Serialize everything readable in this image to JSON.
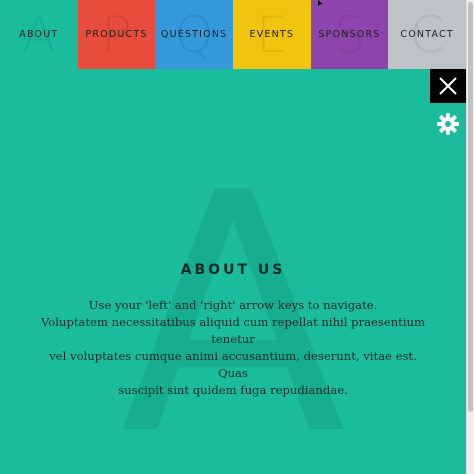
{
  "nav": {
    "items": [
      {
        "label": "ABOUT",
        "letter": "A",
        "color": "#1abc9c"
      },
      {
        "label": "PRODUCTS",
        "letter": "P",
        "color": "#e74c3c"
      },
      {
        "label": "QUESTIONS",
        "letter": "Q",
        "color": "#3498db"
      },
      {
        "label": "EVENTS",
        "letter": "E",
        "color": "#f1c40f"
      },
      {
        "label": "SPONSORS",
        "letter": "S",
        "color": "#8e44ad"
      },
      {
        "label": "CONTACT",
        "letter": "C",
        "color": "#bdc3c7"
      }
    ]
  },
  "main": {
    "background_letter": "A",
    "title": "ABOUT US",
    "lines": [
      "Use your 'left' and 'right' arrow keys to navigate.",
      "Voluptatem necessitatibus aliquid cum repellat nihil praesentium tenetur",
      "vel voluptates cumque animi accusantium, deserunt, vitae est. Quas",
      "suscipit sint quidem fuga repudiandae."
    ]
  },
  "controls": {
    "close_icon": "close-icon",
    "settings_icon": "gear-icon"
  },
  "colors": {
    "active_background": "#1abc9c",
    "close_button": "#000000"
  }
}
